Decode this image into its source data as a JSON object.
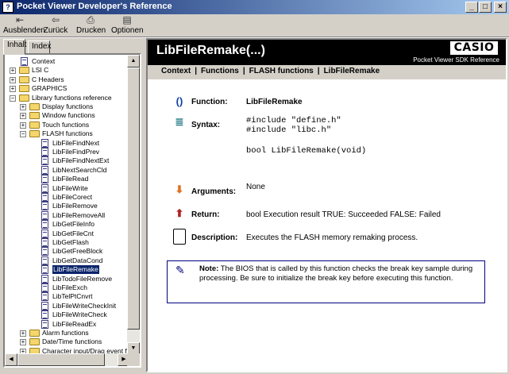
{
  "window": {
    "title": "Pocket Viewer Developer's Reference",
    "app_icon_glyph": "?"
  },
  "toolbar": {
    "buttons": [
      {
        "label": "Ausblenden",
        "icon": "hide-pane-icon",
        "glyph": "⇤"
      },
      {
        "label": "Zurück",
        "icon": "back-arrow-icon",
        "glyph": "⇦"
      },
      {
        "label": "Drucken",
        "icon": "printer-icon",
        "glyph": "⎙"
      },
      {
        "label": "Optionen",
        "icon": "options-icon",
        "glyph": "▤"
      }
    ]
  },
  "nav": {
    "tabs": [
      "Inhalt",
      "Index"
    ],
    "active_tab": "Inhalt",
    "tree": [
      {
        "label": "Context",
        "type": "page",
        "level": 0
      },
      {
        "label": "LSI C",
        "type": "folder",
        "level": 0,
        "expander": "+"
      },
      {
        "label": "C Headers",
        "type": "folder",
        "level": 0,
        "expander": "+"
      },
      {
        "label": "GRAPHICS",
        "type": "folder",
        "level": 0,
        "expander": "+"
      },
      {
        "label": "Library functions reference",
        "type": "folder",
        "level": 0,
        "expander": "−"
      },
      {
        "label": "Display functions",
        "type": "folder",
        "level": 1,
        "expander": "+"
      },
      {
        "label": "Window functions",
        "type": "folder",
        "level": 1,
        "expander": "+"
      },
      {
        "label": "Touch functions",
        "type": "folder",
        "level": 1,
        "expander": "+"
      },
      {
        "label": "FLASH functions",
        "type": "folder",
        "level": 1,
        "expander": "−"
      },
      {
        "label": "LibFileFindNext",
        "type": "page",
        "level": 2
      },
      {
        "label": "LibFileFindPrev",
        "type": "page",
        "level": 2
      },
      {
        "label": "LibFileFindNextExt",
        "type": "page",
        "level": 2
      },
      {
        "label": "LibNextSearchCld",
        "type": "page",
        "level": 2
      },
      {
        "label": "LibFileRead",
        "type": "page",
        "level": 2
      },
      {
        "label": "LibFileWrite",
        "type": "page",
        "level": 2
      },
      {
        "label": "LibFileCorect",
        "type": "page",
        "level": 2
      },
      {
        "label": "LibFileRemove",
        "type": "page",
        "level": 2
      },
      {
        "label": "LibFileRemoveAll",
        "type": "page",
        "level": 2
      },
      {
        "label": "LibGetFileInfo",
        "type": "page",
        "level": 2
      },
      {
        "label": "LibGetFileCnt",
        "type": "page",
        "level": 2
      },
      {
        "label": "LibGetFlash",
        "type": "page",
        "level": 2
      },
      {
        "label": "LibGetFreeBlock",
        "type": "page",
        "level": 2
      },
      {
        "label": "LibGetDataCond",
        "type": "page",
        "level": 2
      },
      {
        "label": "LibFileRemake",
        "type": "page",
        "level": 2,
        "selected": true
      },
      {
        "label": "LibTodoFileRemove",
        "type": "page",
        "level": 2
      },
      {
        "label": "LibFileExch",
        "type": "page",
        "level": 2
      },
      {
        "label": "LibTelPtCnvrt",
        "type": "page",
        "level": 2
      },
      {
        "label": "LibFileWriteCheckInit",
        "type": "page",
        "level": 2
      },
      {
        "label": "LibFileWriteCheck",
        "type": "page",
        "level": 2
      },
      {
        "label": "LibFileReadEx",
        "type": "page",
        "level": 2
      },
      {
        "label": "Alarm functions",
        "type": "folder",
        "level": 1,
        "expander": "+"
      },
      {
        "label": "Date/Time functions",
        "type": "folder",
        "level": 1,
        "expander": "+"
      },
      {
        "label": "Character input/Drag event fur",
        "type": "folder",
        "level": 1,
        "expander": "+"
      }
    ]
  },
  "content": {
    "page_title": "LibFileRemake(...)",
    "logo_text": "CASIO",
    "subtitle": "Pocket Viewer SDK Reference",
    "breadcrumb": [
      "Context",
      "Functions",
      "FLASH functions",
      "LibFileRemake"
    ],
    "function_label": "Function:",
    "function_value": "LibFileRemake",
    "syntax_label": "Syntax:",
    "syntax_lines": [
      "#include \"define.h\"",
      "#include \"libc.h\"",
      "",
      "bool LibFileRemake(void)"
    ],
    "arguments_label": "Arguments:",
    "arguments_value": "None",
    "return_label": "Return:",
    "return_value": "bool Execution result TRUE: Succeeded FALSE: Failed",
    "description_label": "Description:",
    "description_value": "Executes the FLASH memory remaking process.",
    "note_label": "Note:",
    "note_text": "The BIOS that is called by this function checks the break key sample during processing. Be sure to initialize the break key before executing this function."
  },
  "colors": {
    "title_gradient_start": "#0a246a",
    "header_bg": "#000000",
    "note_border": "#000080",
    "selection": "#0a246a"
  }
}
